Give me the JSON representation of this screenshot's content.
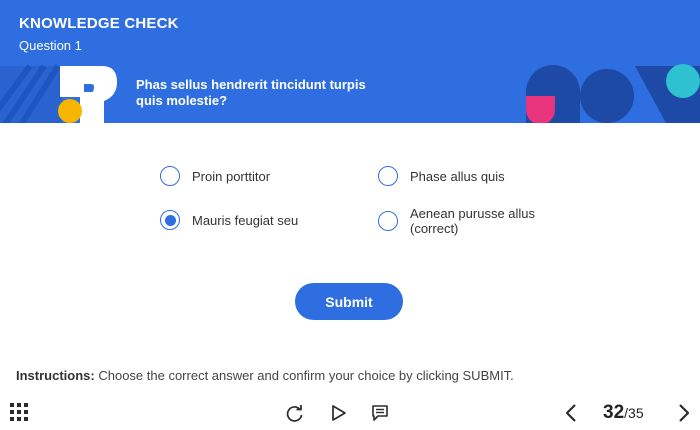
{
  "header": {
    "title": "KNOWLEDGE CHECK",
    "subtitle": "Question 1",
    "question": "Phas sellus hendrerit tincidunt turpis quis molestie?"
  },
  "options": [
    {
      "label": "Proin porttitor",
      "selected": false
    },
    {
      "label": "Phase allus quis",
      "selected": false
    },
    {
      "label": "Mauris feugiat seu",
      "selected": true
    },
    {
      "label": "Aenean purusse allus (correct)",
      "selected": false
    }
  ],
  "submit_label": "Submit",
  "instructions": {
    "prefix": "Instructions:",
    "text": " Choose the correct answer and confirm your choice by clicking SUBMIT."
  },
  "pager": {
    "current": "32",
    "separator": "/",
    "total": "35"
  },
  "icons": {
    "menu": "grid-menu-icon",
    "replay": "replay-icon",
    "play": "play-icon",
    "captions": "captions-icon",
    "prev": "chevron-left-icon",
    "next": "chevron-right-icon"
  },
  "colors": {
    "accent": "#2f6ee0",
    "pink": "#e8337d",
    "yellow": "#f7b500",
    "teal": "#2ec1d1",
    "navy": "#1c4aa6"
  }
}
